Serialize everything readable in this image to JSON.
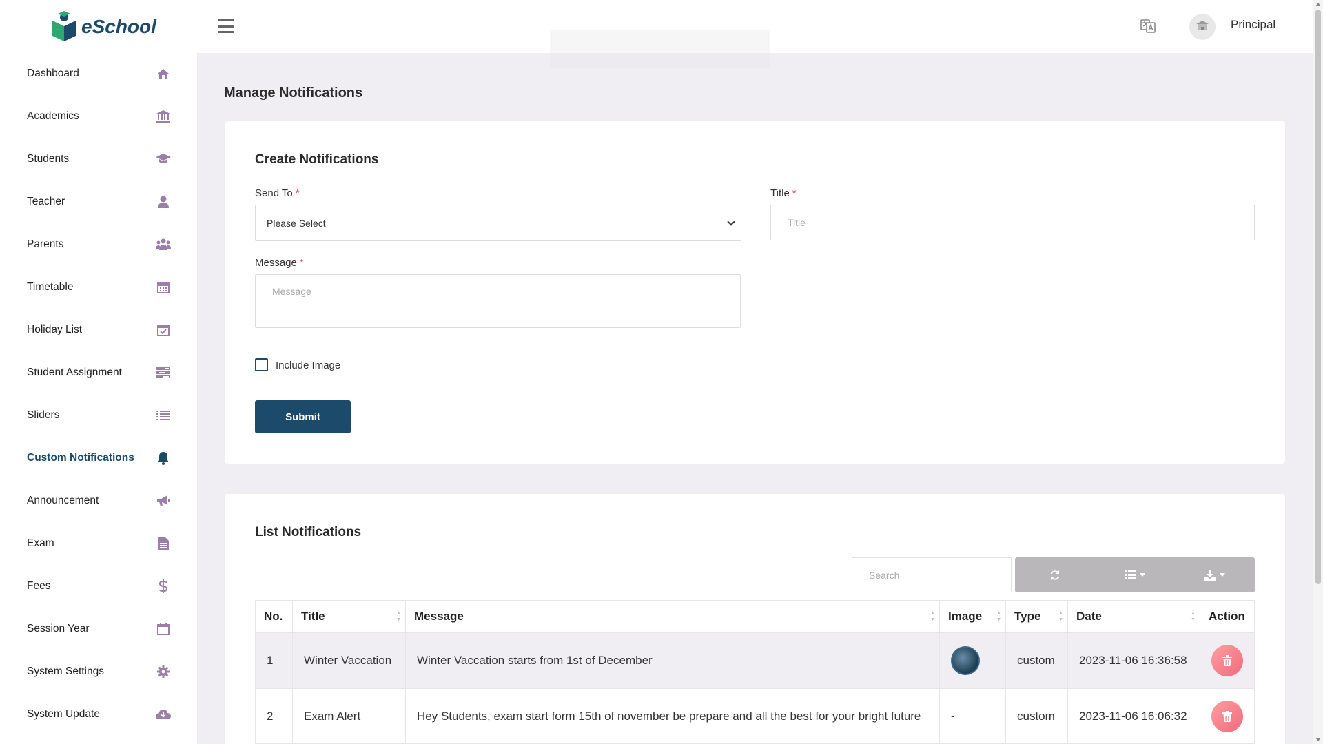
{
  "app": {
    "name": "eSchool"
  },
  "sidebar": {
    "items": [
      {
        "label": "Dashboard",
        "icon": "home-icon"
      },
      {
        "label": "Academics",
        "icon": "institution-icon"
      },
      {
        "label": "Students",
        "icon": "graduation-cap-icon"
      },
      {
        "label": "Teacher",
        "icon": "user-icon"
      },
      {
        "label": "Parents",
        "icon": "users-icon"
      },
      {
        "label": "Timetable",
        "icon": "calendar-icon"
      },
      {
        "label": "Holiday List",
        "icon": "calendar-check-icon"
      },
      {
        "label": "Student Assignment",
        "icon": "tasks-icon"
      },
      {
        "label": "Sliders",
        "icon": "list-icon"
      },
      {
        "label": "Custom Notifications",
        "icon": "bell-icon",
        "active": true
      },
      {
        "label": "Announcement",
        "icon": "bullhorn-icon"
      },
      {
        "label": "Exam",
        "icon": "file-icon"
      },
      {
        "label": "Fees",
        "icon": "dollar-icon"
      },
      {
        "label": "Session Year",
        "icon": "calendar-empty-icon"
      },
      {
        "label": "System Settings",
        "icon": "gear-icon"
      },
      {
        "label": "System Update",
        "icon": "cloud-download-icon"
      }
    ]
  },
  "header": {
    "user_name": "Principal"
  },
  "page": {
    "title": "Manage Notifications"
  },
  "create_form": {
    "title": "Create Notifications",
    "send_to_label": "Send To",
    "send_to_value": "Please Select",
    "title_label": "Title",
    "title_placeholder": "Title",
    "message_label": "Message",
    "message_placeholder": "Message",
    "required_mark": "*",
    "include_image_label": "Include Image",
    "submit_label": "Submit"
  },
  "list": {
    "title": "List Notifications",
    "search_placeholder": "Search",
    "columns": [
      "No.",
      "Title",
      "Message",
      "Image",
      "Type",
      "Date",
      "Action"
    ],
    "rows": [
      {
        "no": "1",
        "title": "Winter Vaccation",
        "message": "Winter Vaccation starts from 1st of December",
        "image": "",
        "type": "custom",
        "date": "2023-11-06 16:36:58"
      },
      {
        "no": "2",
        "title": "Exam Alert",
        "message": "Hey Students, exam start form 15th of november be prepare and all the best for your bright future",
        "image": "-",
        "type": "custom",
        "date": "2023-11-06 16:06:32"
      }
    ]
  },
  "colors": {
    "primary": "#1c4a6b",
    "accent": "#2ea86e",
    "icon": "#9b7fa8",
    "delete": "#f06a7e"
  }
}
